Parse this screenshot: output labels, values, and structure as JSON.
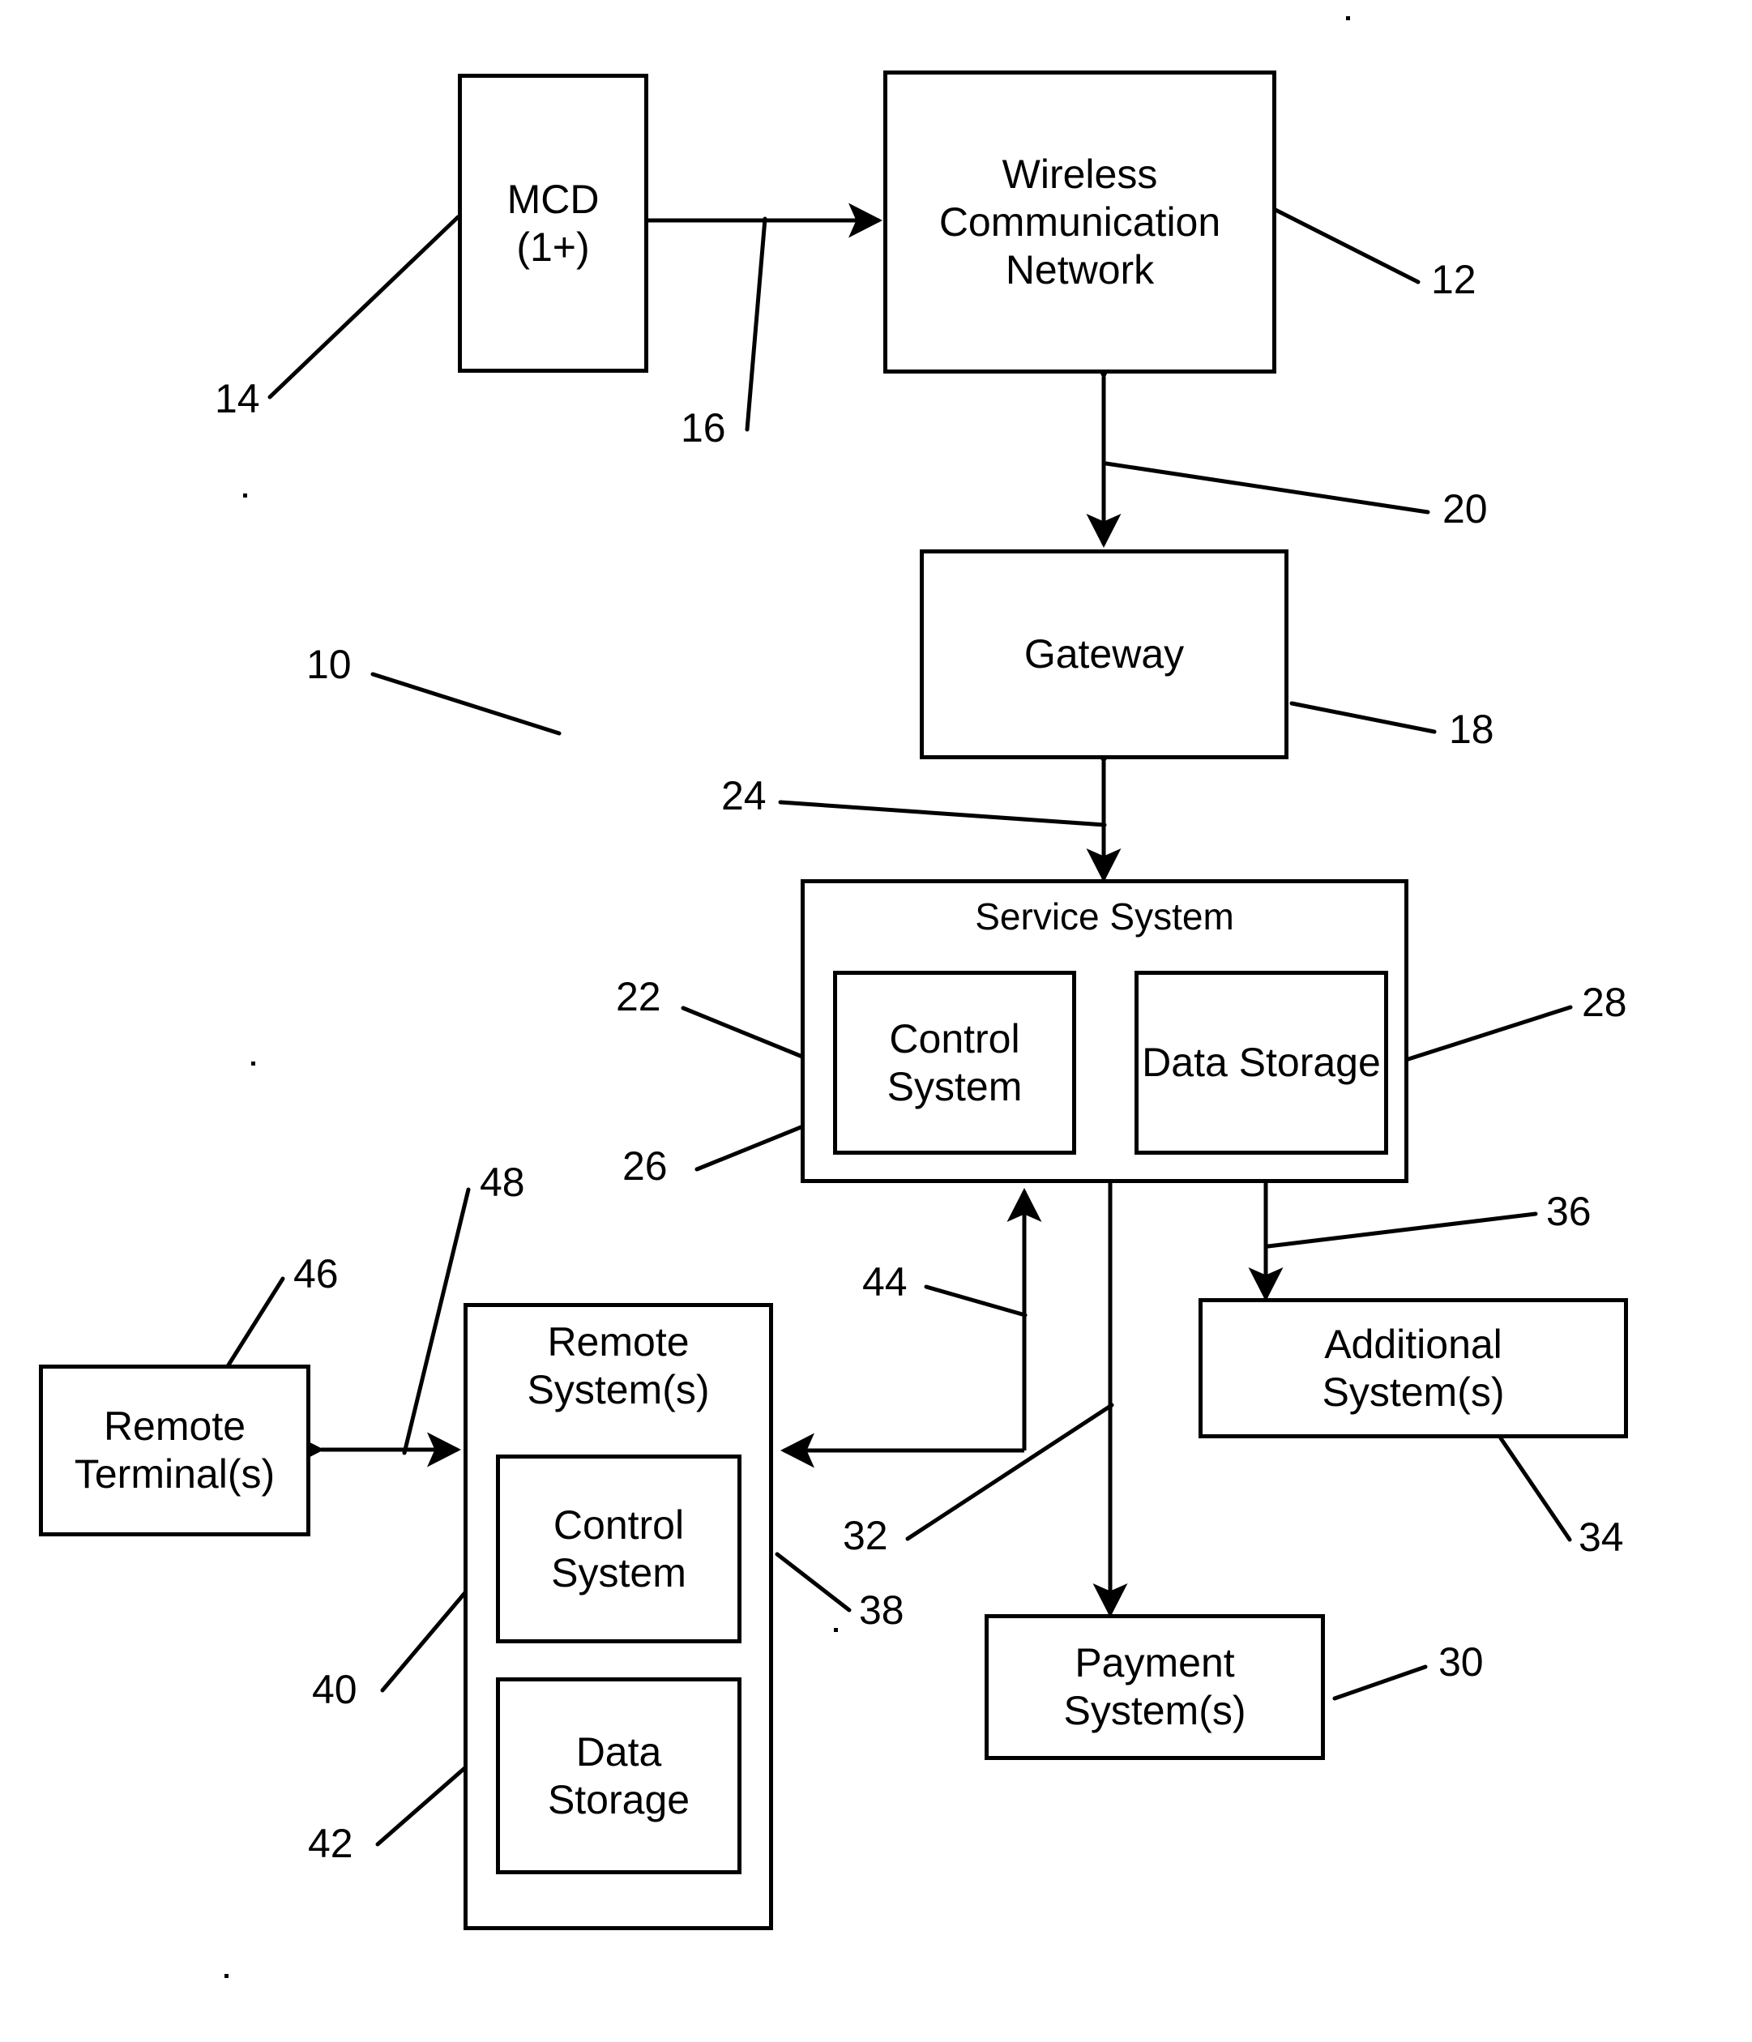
{
  "figure": {
    "type": "patent-block-diagram",
    "overall_ref": "10",
    "nodes": {
      "mcd": {
        "label": "MCD\n(1+)",
        "ref": "14"
      },
      "wireless_network": {
        "label": "Wireless\nCommunication\nNetwork",
        "ref": "12"
      },
      "gateway": {
        "label": "Gateway",
        "ref": "18"
      },
      "service_system": {
        "label": "Service System",
        "ref": "22"
      },
      "service_control_system": {
        "label": "Control\nSystem",
        "ref": "26"
      },
      "service_data_storage": {
        "label": "Data\nStorage",
        "ref": "28"
      },
      "additional_systems": {
        "label": "Additional\nSystem(s)",
        "ref": "34"
      },
      "payment_systems": {
        "label": "Payment\nSystem(s)",
        "ref": "30"
      },
      "remote_systems": {
        "label": "Remote\nSystem(s)",
        "ref": "38"
      },
      "remote_control_system": {
        "label": "Control\nSystem",
        "ref": "40"
      },
      "remote_data_storage": {
        "label": "Data\nStorage",
        "ref": "42"
      },
      "remote_terminals": {
        "label": "Remote\nTerminal(s)",
        "ref": "46"
      }
    },
    "links": {
      "mcd_to_network": {
        "ref": "16"
      },
      "network_to_gateway": {
        "ref": "20"
      },
      "gateway_to_service": {
        "ref": "24"
      },
      "service_to_payment": {
        "ref": "32"
      },
      "service_to_additional": {
        "ref": "36"
      },
      "service_to_remote": {
        "ref": "44"
      },
      "remote_terminal_to_remote_system": {
        "ref": "48"
      }
    },
    "reference_numerals": [
      {
        "id": "10",
        "text": "10"
      },
      {
        "id": "12",
        "text": "12"
      },
      {
        "id": "14",
        "text": "14"
      },
      {
        "id": "16",
        "text": "16"
      },
      {
        "id": "18",
        "text": "18"
      },
      {
        "id": "20",
        "text": "20"
      },
      {
        "id": "22",
        "text": "22"
      },
      {
        "id": "24",
        "text": "24"
      },
      {
        "id": "26",
        "text": "26"
      },
      {
        "id": "28",
        "text": "28"
      },
      {
        "id": "30",
        "text": "30"
      },
      {
        "id": "32",
        "text": "32"
      },
      {
        "id": "34",
        "text": "34"
      },
      {
        "id": "36",
        "text": "36"
      },
      {
        "id": "38",
        "text": "38"
      },
      {
        "id": "40",
        "text": "40"
      },
      {
        "id": "42",
        "text": "42"
      },
      {
        "id": "44",
        "text": "44"
      },
      {
        "id": "46",
        "text": "46"
      },
      {
        "id": "48",
        "text": "48"
      }
    ],
    "colors": {
      "ink": "#000000",
      "paper": "#ffffff"
    }
  }
}
